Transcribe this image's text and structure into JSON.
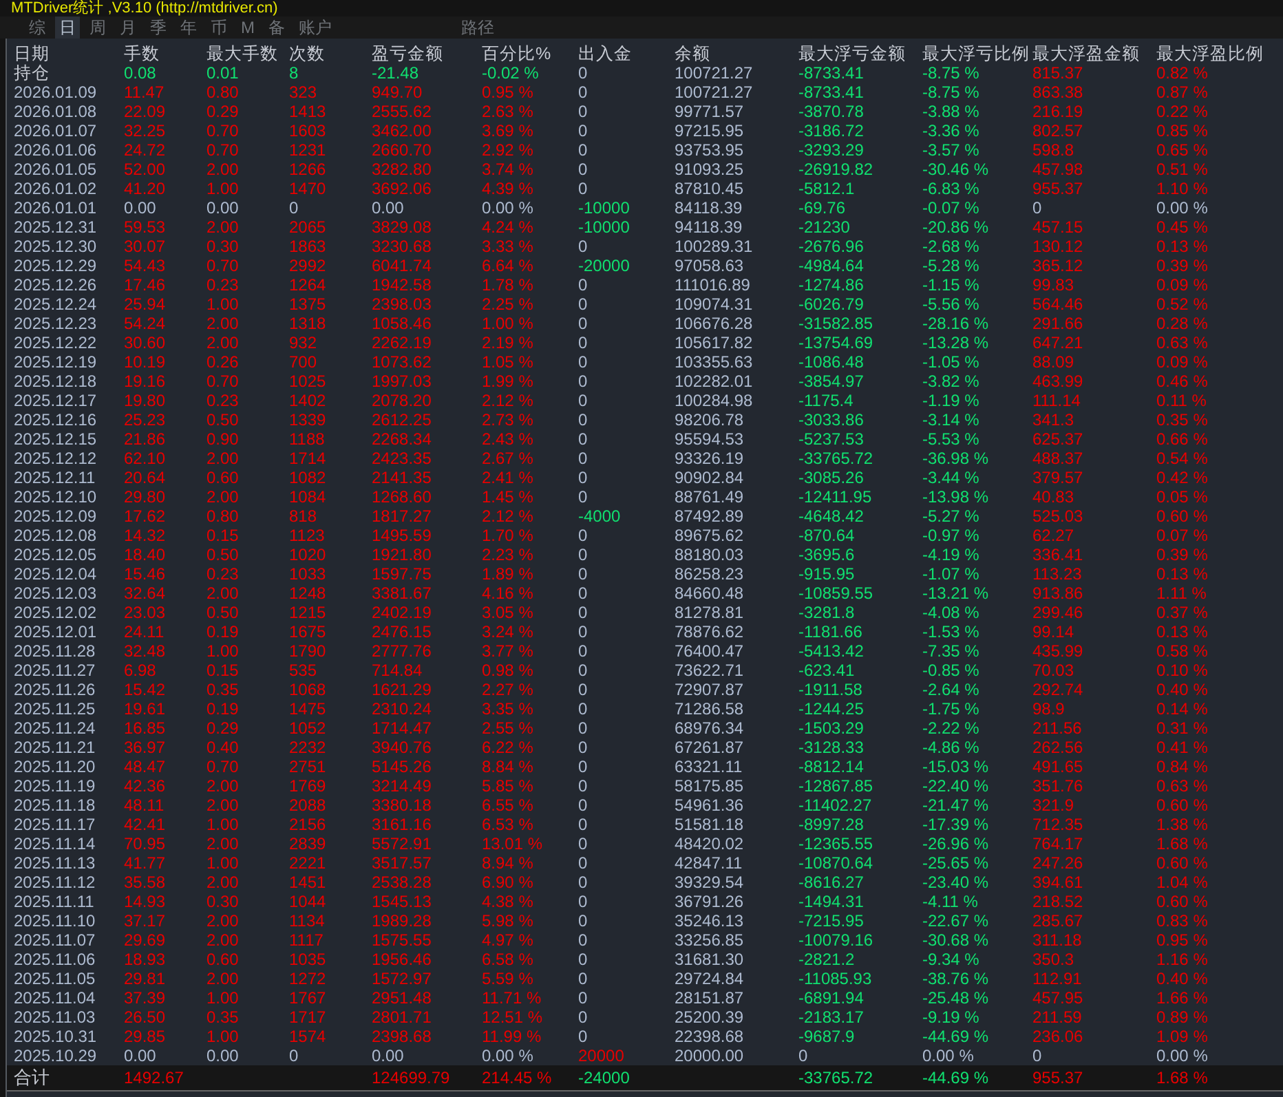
{
  "title": "MTDriver统计 ,V3.10 (http://mtdriver.cn)",
  "tabs": [
    {
      "label": "综",
      "selected": false
    },
    {
      "label": "日",
      "selected": true
    },
    {
      "label": "周",
      "selected": false
    },
    {
      "label": "月",
      "selected": false
    },
    {
      "label": "季",
      "selected": false
    },
    {
      "label": "年",
      "selected": false
    },
    {
      "label": "币",
      "selected": false
    },
    {
      "label": "M",
      "selected": false
    },
    {
      "label": "备",
      "selected": false
    },
    {
      "label": "账户",
      "selected": false
    },
    {
      "label": "路径",
      "selected": false
    }
  ],
  "table": {
    "columns": [
      "日期",
      "手数",
      "最大手数",
      "次数",
      "盈亏金额",
      "百分比%",
      "出入金",
      "余额",
      "最大浮亏金额",
      "最大浮亏比例",
      "最大浮盈金额",
      "最大浮盈比例"
    ],
    "holding": {
      "label": "持仓",
      "cells": [
        "0.08",
        "0.01",
        "8",
        "-21.48",
        "-0.02 %",
        "0",
        "100721.27",
        "-8733.41",
        "-8.75 %",
        "815.37",
        "0.82 %"
      ]
    },
    "rows": [
      [
        "2026.01.09",
        "11.47",
        "0.80",
        "323",
        "949.70",
        "0.95 %",
        "0",
        "100721.27",
        "-8733.41",
        "-8.75 %",
        "863.38",
        "0.87 %"
      ],
      [
        "2026.01.08",
        "22.09",
        "0.29",
        "1413",
        "2555.62",
        "2.63 %",
        "0",
        "99771.57",
        "-3870.78",
        "-3.88 %",
        "216.19",
        "0.22 %"
      ],
      [
        "2026.01.07",
        "32.25",
        "0.70",
        "1603",
        "3462.00",
        "3.69 %",
        "0",
        "97215.95",
        "-3186.72",
        "-3.36 %",
        "802.57",
        "0.85 %"
      ],
      [
        "2026.01.06",
        "24.72",
        "0.70",
        "1231",
        "2660.70",
        "2.92 %",
        "0",
        "93753.95",
        "-3293.29",
        "-3.57 %",
        "598.8",
        "0.65 %"
      ],
      [
        "2026.01.05",
        "52.00",
        "2.00",
        "1266",
        "3282.80",
        "3.74 %",
        "0",
        "91093.25",
        "-26919.82",
        "-30.46 %",
        "457.98",
        "0.51 %"
      ],
      [
        "2026.01.02",
        "41.20",
        "1.00",
        "1470",
        "3692.06",
        "4.39 %",
        "0",
        "87810.45",
        "-5812.1",
        "-6.83 %",
        "955.37",
        "1.10 %"
      ],
      [
        "2026.01.01",
        "0.00",
        "0.00",
        "0",
        "0.00",
        "0.00 %",
        "-10000",
        "84118.39",
        "-69.76",
        "-0.07 %",
        "0",
        "0.00 %"
      ],
      [
        "2025.12.31",
        "59.53",
        "2.00",
        "2065",
        "3829.08",
        "4.24 %",
        "-10000",
        "94118.39",
        "-21230",
        "-20.86 %",
        "457.15",
        "0.45 %"
      ],
      [
        "2025.12.30",
        "30.07",
        "0.30",
        "1863",
        "3230.68",
        "3.33 %",
        "0",
        "100289.31",
        "-2676.96",
        "-2.68 %",
        "130.12",
        "0.13 %"
      ],
      [
        "2025.12.29",
        "54.43",
        "0.70",
        "2992",
        "6041.74",
        "6.64 %",
        "-20000",
        "97058.63",
        "-4984.64",
        "-5.28 %",
        "365.12",
        "0.39 %"
      ],
      [
        "2025.12.26",
        "17.46",
        "0.23",
        "1264",
        "1942.58",
        "1.78 %",
        "0",
        "111016.89",
        "-1274.86",
        "-1.15 %",
        "99.83",
        "0.09 %"
      ],
      [
        "2025.12.24",
        "25.94",
        "1.00",
        "1375",
        "2398.03",
        "2.25 %",
        "0",
        "109074.31",
        "-6026.79",
        "-5.56 %",
        "564.46",
        "0.52 %"
      ],
      [
        "2025.12.23",
        "54.24",
        "2.00",
        "1318",
        "1058.46",
        "1.00 %",
        "0",
        "106676.28",
        "-31582.85",
        "-28.16 %",
        "291.66",
        "0.28 %"
      ],
      [
        "2025.12.22",
        "30.60",
        "2.00",
        "932",
        "2262.19",
        "2.19 %",
        "0",
        "105617.82",
        "-13754.69",
        "-13.28 %",
        "647.21",
        "0.63 %"
      ],
      [
        "2025.12.19",
        "10.19",
        "0.26",
        "700",
        "1073.62",
        "1.05 %",
        "0",
        "103355.63",
        "-1086.48",
        "-1.05 %",
        "88.09",
        "0.09 %"
      ],
      [
        "2025.12.18",
        "19.16",
        "0.70",
        "1025",
        "1997.03",
        "1.99 %",
        "0",
        "102282.01",
        "-3854.97",
        "-3.82 %",
        "463.99",
        "0.46 %"
      ],
      [
        "2025.12.17",
        "19.80",
        "0.23",
        "1402",
        "2078.20",
        "2.12 %",
        "0",
        "100284.98",
        "-1175.4",
        "-1.19 %",
        "111.14",
        "0.11 %"
      ],
      [
        "2025.12.16",
        "25.23",
        "0.50",
        "1339",
        "2612.25",
        "2.73 %",
        "0",
        "98206.78",
        "-3033.86",
        "-3.14 %",
        "341.3",
        "0.35 %"
      ],
      [
        "2025.12.15",
        "21.86",
        "0.90",
        "1188",
        "2268.34",
        "2.43 %",
        "0",
        "95594.53",
        "-5237.53",
        "-5.53 %",
        "625.37",
        "0.66 %"
      ],
      [
        "2025.12.12",
        "62.10",
        "2.00",
        "1714",
        "2423.35",
        "2.67 %",
        "0",
        "93326.19",
        "-33765.72",
        "-36.98 %",
        "488.37",
        "0.54 %"
      ],
      [
        "2025.12.11",
        "20.64",
        "0.60",
        "1082",
        "2141.35",
        "2.41 %",
        "0",
        "90902.84",
        "-3085.26",
        "-3.44 %",
        "379.57",
        "0.42 %"
      ],
      [
        "2025.12.10",
        "29.80",
        "2.00",
        "1084",
        "1268.60",
        "1.45 %",
        "0",
        "88761.49",
        "-12411.95",
        "-13.98 %",
        "40.83",
        "0.05 %"
      ],
      [
        "2025.12.09",
        "17.62",
        "0.80",
        "818",
        "1817.27",
        "2.12 %",
        "-4000",
        "87492.89",
        "-4648.42",
        "-5.27 %",
        "525.03",
        "0.60 %"
      ],
      [
        "2025.12.08",
        "14.32",
        "0.15",
        "1123",
        "1495.59",
        "1.70 %",
        "0",
        "89675.62",
        "-870.64",
        "-0.97 %",
        "62.27",
        "0.07 %"
      ],
      [
        "2025.12.05",
        "18.40",
        "0.50",
        "1020",
        "1921.80",
        "2.23 %",
        "0",
        "88180.03",
        "-3695.6",
        "-4.19 %",
        "336.41",
        "0.39 %"
      ],
      [
        "2025.12.04",
        "15.46",
        "0.23",
        "1033",
        "1597.75",
        "1.89 %",
        "0",
        "86258.23",
        "-915.95",
        "-1.07 %",
        "113.23",
        "0.13 %"
      ],
      [
        "2025.12.03",
        "32.64",
        "2.00",
        "1248",
        "3381.67",
        "4.16 %",
        "0",
        "84660.48",
        "-10859.55",
        "-13.21 %",
        "913.86",
        "1.11 %"
      ],
      [
        "2025.12.02",
        "23.03",
        "0.50",
        "1215",
        "2402.19",
        "3.05 %",
        "0",
        "81278.81",
        "-3281.8",
        "-4.08 %",
        "299.46",
        "0.37 %"
      ],
      [
        "2025.12.01",
        "24.11",
        "0.19",
        "1675",
        "2476.15",
        "3.24 %",
        "0",
        "78876.62",
        "-1181.66",
        "-1.53 %",
        "99.14",
        "0.13 %"
      ],
      [
        "2025.11.28",
        "32.48",
        "1.00",
        "1790",
        "2777.76",
        "3.77 %",
        "0",
        "76400.47",
        "-5413.42",
        "-7.35 %",
        "435.99",
        "0.58 %"
      ],
      [
        "2025.11.27",
        "6.98",
        "0.15",
        "535",
        "714.84",
        "0.98 %",
        "0",
        "73622.71",
        "-623.41",
        "-0.85 %",
        "70.03",
        "0.10 %"
      ],
      [
        "2025.11.26",
        "15.42",
        "0.35",
        "1068",
        "1621.29",
        "2.27 %",
        "0",
        "72907.87",
        "-1911.58",
        "-2.64 %",
        "292.74",
        "0.40 %"
      ],
      [
        "2025.11.25",
        "19.61",
        "0.19",
        "1475",
        "2310.24",
        "3.35 %",
        "0",
        "71286.58",
        "-1244.25",
        "-1.75 %",
        "98.9",
        "0.14 %"
      ],
      [
        "2025.11.24",
        "16.85",
        "0.29",
        "1052",
        "1714.47",
        "2.55 %",
        "0",
        "68976.34",
        "-1503.29",
        "-2.22 %",
        "211.56",
        "0.31 %"
      ],
      [
        "2025.11.21",
        "36.97",
        "0.40",
        "2232",
        "3940.76",
        "6.22 %",
        "0",
        "67261.87",
        "-3128.33",
        "-4.86 %",
        "262.56",
        "0.41 %"
      ],
      [
        "2025.11.20",
        "48.47",
        "0.70",
        "2751",
        "5145.26",
        "8.84 %",
        "0",
        "63321.11",
        "-8812.14",
        "-15.03 %",
        "491.65",
        "0.84 %"
      ],
      [
        "2025.11.19",
        "42.36",
        "2.00",
        "1769",
        "3214.49",
        "5.85 %",
        "0",
        "58175.85",
        "-12867.85",
        "-22.40 %",
        "351.76",
        "0.63 %"
      ],
      [
        "2025.11.18",
        "48.11",
        "2.00",
        "2088",
        "3380.18",
        "6.55 %",
        "0",
        "54961.36",
        "-11402.27",
        "-21.47 %",
        "321.9",
        "0.60 %"
      ],
      [
        "2025.11.17",
        "42.41",
        "1.00",
        "2156",
        "3161.16",
        "6.53 %",
        "0",
        "51581.18",
        "-8997.28",
        "-17.39 %",
        "712.35",
        "1.38 %"
      ],
      [
        "2025.11.14",
        "70.95",
        "2.00",
        "2839",
        "5572.91",
        "13.01 %",
        "0",
        "48420.02",
        "-12365.55",
        "-26.96 %",
        "764.17",
        "1.68 %"
      ],
      [
        "2025.11.13",
        "41.77",
        "1.00",
        "2221",
        "3517.57",
        "8.94 %",
        "0",
        "42847.11",
        "-10870.64",
        "-25.65 %",
        "247.26",
        "0.60 %"
      ],
      [
        "2025.11.12",
        "35.58",
        "2.00",
        "1451",
        "2538.28",
        "6.90 %",
        "0",
        "39329.54",
        "-8616.27",
        "-23.40 %",
        "394.61",
        "1.04 %"
      ],
      [
        "2025.11.11",
        "14.93",
        "0.30",
        "1044",
        "1545.13",
        "4.38 %",
        "0",
        "36791.26",
        "-1494.31",
        "-4.11 %",
        "218.52",
        "0.60 %"
      ],
      [
        "2025.11.10",
        "37.17",
        "2.00",
        "1134",
        "1989.28",
        "5.98 %",
        "0",
        "35246.13",
        "-7215.95",
        "-22.67 %",
        "285.67",
        "0.83 %"
      ],
      [
        "2025.11.07",
        "29.69",
        "2.00",
        "1117",
        "1575.55",
        "4.97 %",
        "0",
        "33256.85",
        "-10079.16",
        "-30.68 %",
        "311.18",
        "0.95 %"
      ],
      [
        "2025.11.06",
        "18.93",
        "0.60",
        "1035",
        "1956.46",
        "6.58 %",
        "0",
        "31681.30",
        "-2821.2",
        "-9.34 %",
        "350.3",
        "1.16 %"
      ],
      [
        "2025.11.05",
        "29.81",
        "2.00",
        "1272",
        "1572.97",
        "5.59 %",
        "0",
        "29724.84",
        "-11085.93",
        "-38.76 %",
        "112.91",
        "0.40 %"
      ],
      [
        "2025.11.04",
        "37.39",
        "1.00",
        "1767",
        "2951.48",
        "11.71 %",
        "0",
        "28151.87",
        "-6891.94",
        "-25.48 %",
        "457.95",
        "1.66 %"
      ],
      [
        "2025.11.03",
        "26.50",
        "0.35",
        "1717",
        "2801.71",
        "12.51 %",
        "0",
        "25200.39",
        "-2183.17",
        "-9.19 %",
        "211.59",
        "0.89 %"
      ],
      [
        "2025.10.31",
        "29.85",
        "1.00",
        "1574",
        "2398.68",
        "11.99 %",
        "0",
        "22398.68",
        "-9687.9",
        "-44.69 %",
        "236.06",
        "1.09 %"
      ],
      [
        "2025.10.29",
        "0.00",
        "0.00",
        "0",
        "0.00",
        "0.00 %",
        "20000",
        "20000.00",
        "0",
        "0.00 %",
        "0",
        "0.00 %"
      ]
    ],
    "total": {
      "label": "合计",
      "cells": [
        "1492.67",
        null,
        null,
        "124699.79",
        "214.45 %",
        "-24000",
        null,
        "-33765.72",
        "-44.69 %",
        "955.37",
        "1.68 %"
      ]
    }
  }
}
